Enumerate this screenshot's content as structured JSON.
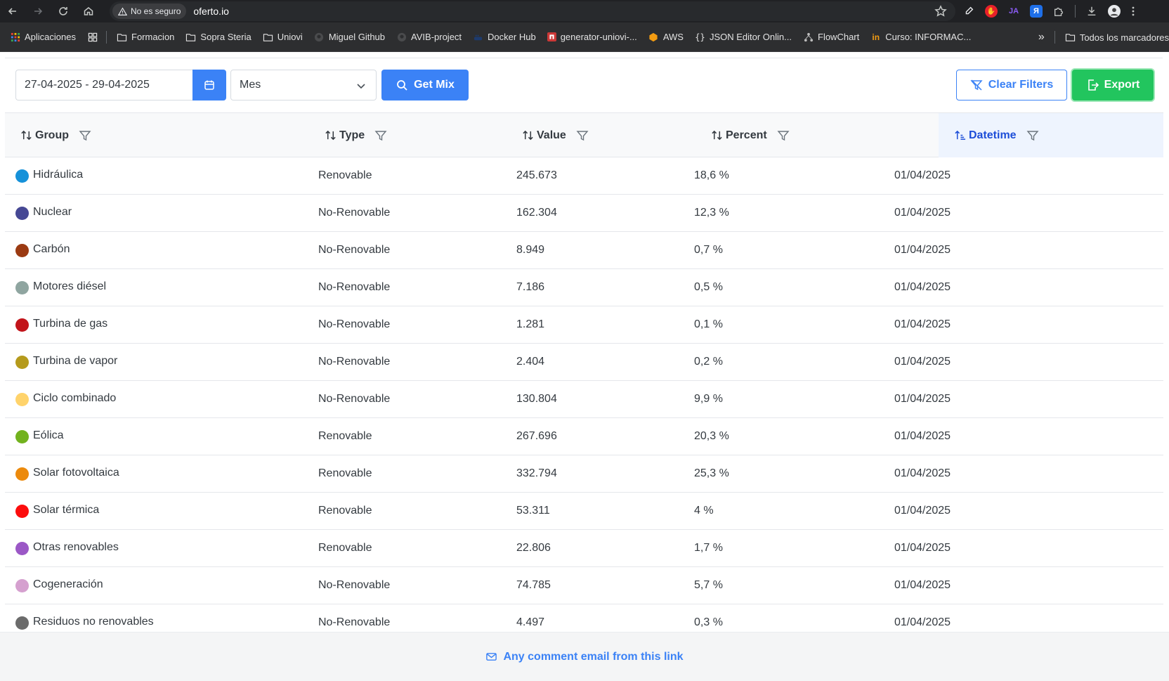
{
  "browser": {
    "security_label": "No es seguro",
    "url": "oferto.io",
    "bookmarks": [
      {
        "label": "Aplicaciones",
        "icon": "apps-grid-icon"
      },
      {
        "label": "",
        "icon": "grid-icon"
      },
      {
        "label": "Formacion",
        "icon": "folder-icon"
      },
      {
        "label": "Sopra Steria",
        "icon": "folder-icon"
      },
      {
        "label": "Uniovi",
        "icon": "folder-icon"
      },
      {
        "label": "Miguel Github",
        "icon": "github-icon"
      },
      {
        "label": "AVIB-project",
        "icon": "github-icon"
      },
      {
        "label": "Docker Hub",
        "icon": "docker-icon"
      },
      {
        "label": "generator-uniovi-...",
        "icon": "npm-icon"
      },
      {
        "label": "AWS",
        "icon": "aws-icon"
      },
      {
        "label": "JSON Editor Onlin...",
        "icon": "braces-icon"
      },
      {
        "label": "FlowChart",
        "icon": "flowchart-icon"
      },
      {
        "label": "Curso: INFORMAC...",
        "icon": "in-icon"
      }
    ],
    "overflow_label": "»",
    "all_bookmarks_label": "Todos los marcadores"
  },
  "toolbar": {
    "date_range": "27-04-2025 - 29-04-2025",
    "period": "Mes",
    "get_mix_label": "Get Mix",
    "clear_filters_label": "Clear Filters",
    "export_label": "Export"
  },
  "table": {
    "columns": [
      "Group",
      "Type",
      "Value",
      "Percent",
      "Datetime"
    ],
    "sorted_column": "Datetime",
    "rows": [
      {
        "group": "Hidráulica",
        "type": "Renovable",
        "value": "245.673",
        "percent": "18,6 %",
        "datetime": "01/04/2025",
        "color": "#1591d9"
      },
      {
        "group": "Nuclear",
        "type": "No-Renovable",
        "value": "162.304",
        "percent": "12,3 %",
        "datetime": "01/04/2025",
        "color": "#464894"
      },
      {
        "group": "Carbón",
        "type": "No-Renovable",
        "value": "8.949",
        "percent": "0,7 %",
        "datetime": "01/04/2025",
        "color": "#9b3a12"
      },
      {
        "group": "Motores diésel",
        "type": "No-Renovable",
        "value": "7.186",
        "percent": "0,5 %",
        "datetime": "01/04/2025",
        "color": "#8fa5a0"
      },
      {
        "group": "Turbina de gas",
        "type": "No-Renovable",
        "value": "1.281",
        "percent": "0,1 %",
        "datetime": "01/04/2025",
        "color": "#c2141a"
      },
      {
        "group": "Turbina de vapor",
        "type": "No-Renovable",
        "value": "2.404",
        "percent": "0,2 %",
        "datetime": "01/04/2025",
        "color": "#b59a1c"
      },
      {
        "group": "Ciclo combinado",
        "type": "No-Renovable",
        "value": "130.804",
        "percent": "9,9 %",
        "datetime": "01/04/2025",
        "color": "#ffd36b"
      },
      {
        "group": "Eólica",
        "type": "Renovable",
        "value": "267.696",
        "percent": "20,3 %",
        "datetime": "01/04/2025",
        "color": "#72b21e"
      },
      {
        "group": "Solar fotovoltaica",
        "type": "Renovable",
        "value": "332.794",
        "percent": "25,3 %",
        "datetime": "01/04/2025",
        "color": "#ec8a0c"
      },
      {
        "group": "Solar térmica",
        "type": "Renovable",
        "value": "53.311",
        "percent": "4 %",
        "datetime": "01/04/2025",
        "color": "#fc0d0d"
      },
      {
        "group": "Otras renovables",
        "type": "Renovable",
        "value": "22.806",
        "percent": "1,7 %",
        "datetime": "01/04/2025",
        "color": "#9b58c6"
      },
      {
        "group": "Cogeneración",
        "type": "No-Renovable",
        "value": "74.785",
        "percent": "5,7 %",
        "datetime": "01/04/2025",
        "color": "#d5a0cf"
      },
      {
        "group": "Residuos no renovables",
        "type": "No-Renovable",
        "value": "4.497",
        "percent": "0,3 %",
        "datetime": "01/04/2025",
        "color": "#6b6b6b"
      }
    ]
  },
  "footer": {
    "link_label": "Any comment email from this link"
  },
  "colors": {
    "primary": "#3b82f6",
    "success": "#22c55e"
  }
}
